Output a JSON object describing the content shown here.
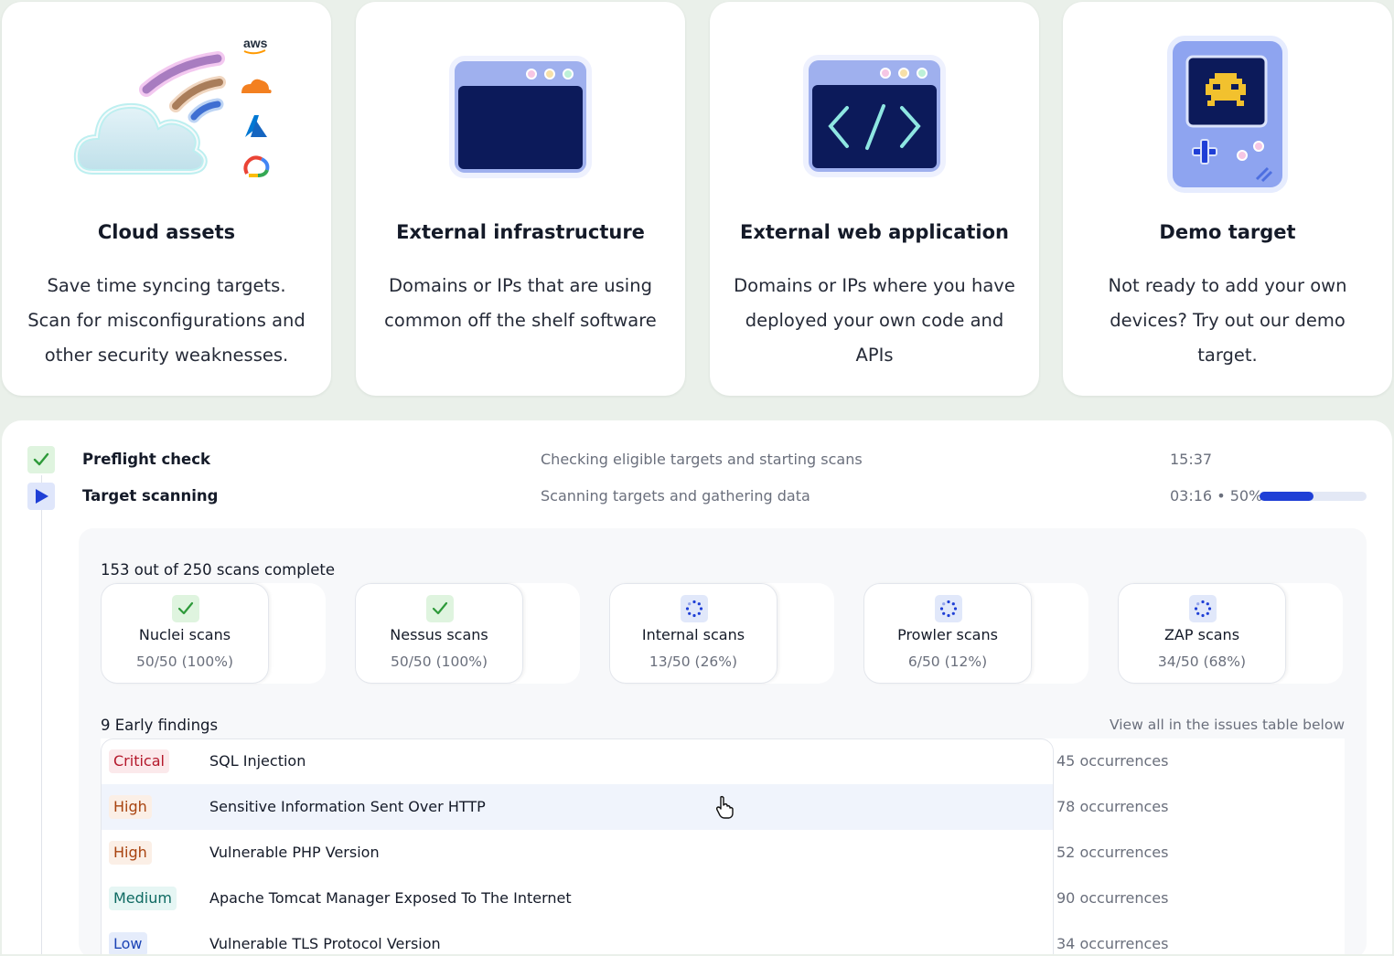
{
  "cards": [
    {
      "title": "Cloud assets",
      "lines": [
        "Save time syncing targets.",
        "Scan for misconfigurations and",
        "other security weaknesses."
      ],
      "icon": "cloud-icon",
      "provider_icons": [
        "aws-logo",
        "cloudflare-logo",
        "azure-logo",
        "google-cloud-logo"
      ],
      "aws_text": "aws"
    },
    {
      "title": "External infrastructure",
      "lines": [
        "Domains or IPs that are using",
        "common off the shelf software"
      ],
      "icon": "browser-window-icon"
    },
    {
      "title": "External web application",
      "lines": [
        "Domains or IPs where you have",
        "deployed your own code and APIs"
      ],
      "icon": "code-window-icon"
    },
    {
      "title": "Demo target",
      "lines": [
        "Not ready to add your own",
        "devices? Try out our demo target."
      ],
      "icon": "game-console-icon"
    }
  ],
  "steps": [
    {
      "name": "Preflight check",
      "description": "Checking eligible targets and starting scans",
      "time": "15:37",
      "status": "done"
    },
    {
      "name": "Target scanning",
      "description": "Scanning targets and gathering data",
      "time": "03:16 • 50%",
      "status": "running",
      "progress": 0.5
    }
  ],
  "scans_header": "153 out of 250 scans complete",
  "scans": [
    {
      "name": "Nuclei scans",
      "count": "50/50 (100%)",
      "status": "complete"
    },
    {
      "name": "Nessus scans",
      "count": "50/50 (100%)",
      "status": "complete"
    },
    {
      "name": "Internal scans",
      "count": "13/50 (26%)",
      "status": "running"
    },
    {
      "name": "Prowler scans",
      "count": "6/50 (12%)",
      "status": "running"
    },
    {
      "name": "ZAP scans",
      "count": "34/50 (68%)",
      "status": "running"
    }
  ],
  "findings_title": "9 Early findings",
  "findings_link": "View all in the issues table below",
  "findings": [
    {
      "severity": "Critical",
      "level": "critical",
      "title": "SQL Injection",
      "occurrences": "45 occurrences"
    },
    {
      "severity": "High",
      "level": "high",
      "title": "Sensitive Information Sent Over HTTP",
      "occurrences": "78 occurrences"
    },
    {
      "severity": "High",
      "level": "high",
      "title": "Vulnerable PHP Version",
      "occurrences": "52 occurrences"
    },
    {
      "severity": "Medium",
      "level": "medium",
      "title": "Apache Tomcat Manager Exposed To The Internet",
      "occurrences": "90 occurrences"
    },
    {
      "severity": "Low",
      "level": "low",
      "title": "Vulnerable TLS Protocol Version",
      "occurrences": "34 occurrences"
    }
  ],
  "colors": {
    "accent": "#1f3fd6",
    "critical": "#b4182b",
    "high": "#a8430f",
    "medium": "#0e6a62",
    "low": "#1c44b5",
    "success": "#2e9a3a"
  }
}
